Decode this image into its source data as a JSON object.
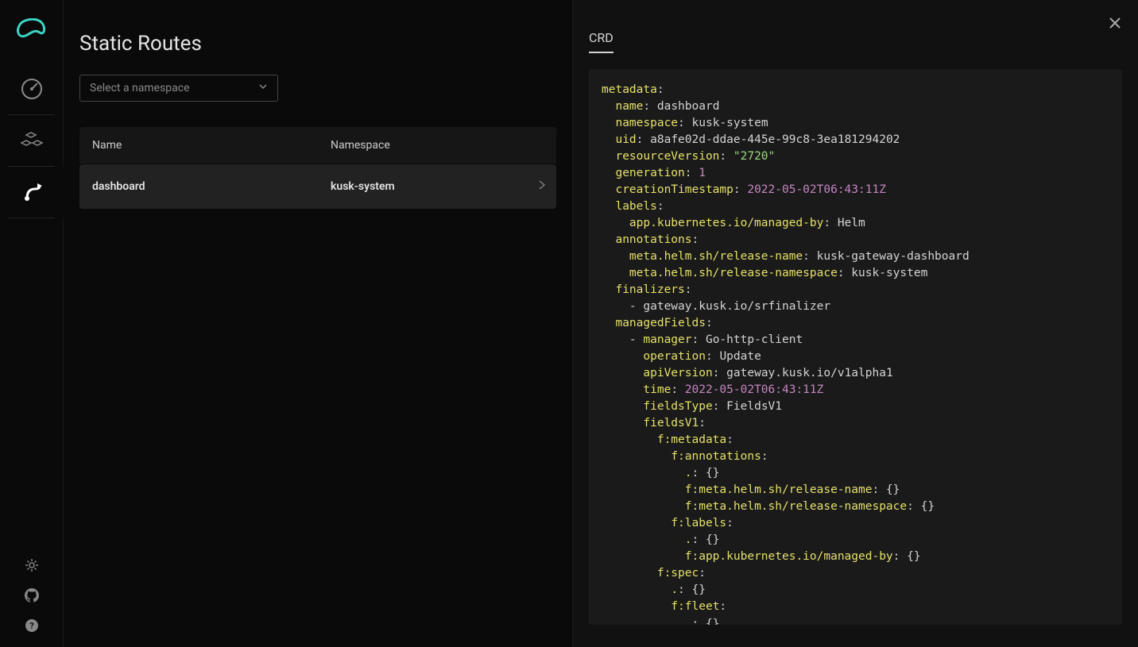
{
  "page": {
    "title": "Static Routes"
  },
  "namespaceSelect": {
    "placeholder": "Select a namespace"
  },
  "table": {
    "headers": {
      "name": "Name",
      "namespace": "Namespace"
    },
    "rows": [
      {
        "name": "dashboard",
        "namespace": "kusk-system"
      }
    ]
  },
  "detail": {
    "tab": "CRD",
    "yaml": {
      "metadata": {
        "name": "dashboard",
        "namespace": "kusk-system",
        "uid": "a8afe02d-ddae-445e-99c8-3ea181294202",
        "resourceVersion": "\"2720\"",
        "generation": "1",
        "creationTimestamp": "2022-05-02T06:43:11Z",
        "labels": {
          "managedBy": "Helm"
        },
        "annotations": {
          "releaseName": "kusk-gateway-dashboard",
          "releaseNamespace": "kusk-system"
        },
        "finalizers": [
          "gateway.kusk.io/srfinalizer"
        ],
        "managedFields": {
          "manager": "Go-http-client",
          "operation": "Update",
          "apiVersion": "gateway.kusk.io/v1alpha1",
          "time": "2022-05-02T06:43:11Z",
          "fieldsType": "FieldsV1"
        }
      }
    }
  }
}
